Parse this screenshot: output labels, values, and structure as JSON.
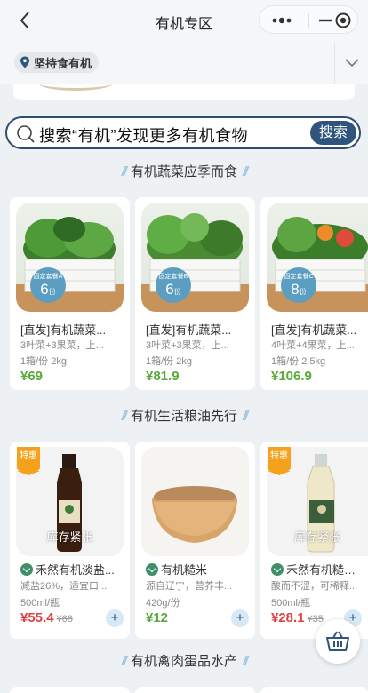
{
  "header": {
    "title": "有机专区"
  },
  "store": {
    "name": "坚持食有机"
  },
  "search": {
    "placeholder": "搜索“有机”发现更多有机食物",
    "button": "搜索"
  },
  "sections": [
    {
      "title": "有机蔬菜应季而食"
    },
    {
      "title": "有机生活粮油先行"
    },
    {
      "title": "有机禽肉蛋品水产"
    }
  ],
  "veg_products": [
    {
      "name": "[直发]有机蔬菜...",
      "desc": "3叶菜+3果菜，上...",
      "spec": "1箱/份 2kg",
      "price": "¥69",
      "badge_label": "固定套餐A",
      "badge_count": "6",
      "badge_unit": "份"
    },
    {
      "name": "[直发]有机蔬菜...",
      "desc": "3叶菜+3果菜，上...",
      "spec": "1箱/份 2kg",
      "price": "¥81.9",
      "badge_label": "固定套餐B",
      "badge_count": "6",
      "badge_unit": "份"
    },
    {
      "name": "[直发]有机蔬菜...",
      "desc": "4叶菜+4果菜，上...",
      "spec": "1箱/份 2.5kg",
      "price": "¥106.9",
      "badge_label": "固定套餐C",
      "badge_count": "8",
      "badge_unit": "份"
    }
  ],
  "grain_products": [
    {
      "name": "禾然有机淡盐...",
      "desc": "减盐26%，适宜口...",
      "spec": "500ml/瓶",
      "price": "¥55.4",
      "original_price": "¥68",
      "special_tag": "特惠",
      "stock_note": "库存紧张"
    },
    {
      "name": "有机糙米",
      "desc": "源自辽宁，营养丰...",
      "spec": "420g/份",
      "price": "¥12",
      "original_price": "",
      "special_tag": "",
      "stock_note": ""
    },
    {
      "name": "禾然有机糙米...",
      "desc": "酸而不涩，可稀释...",
      "spec": "500ml/瓶",
      "price": "¥28.1",
      "original_price": "¥35",
      "special_tag": "特惠",
      "stock_note": "库存紧张"
    }
  ],
  "colors": {
    "accent": "#2f557c",
    "price_green": "#5aa83a",
    "price_red": "#e04040",
    "badge_blue": "#5b9ec1",
    "special_orange": "#f4a11c"
  },
  "icons": {
    "back": "chevron-left-icon",
    "more": "more-dots-icon",
    "minimize": "minus-icon",
    "close": "target-circle-icon",
    "location": "map-pin-icon",
    "expand": "chevron-down-icon",
    "search": "search-icon",
    "add": "plus-icon",
    "cart": "basket-icon"
  }
}
